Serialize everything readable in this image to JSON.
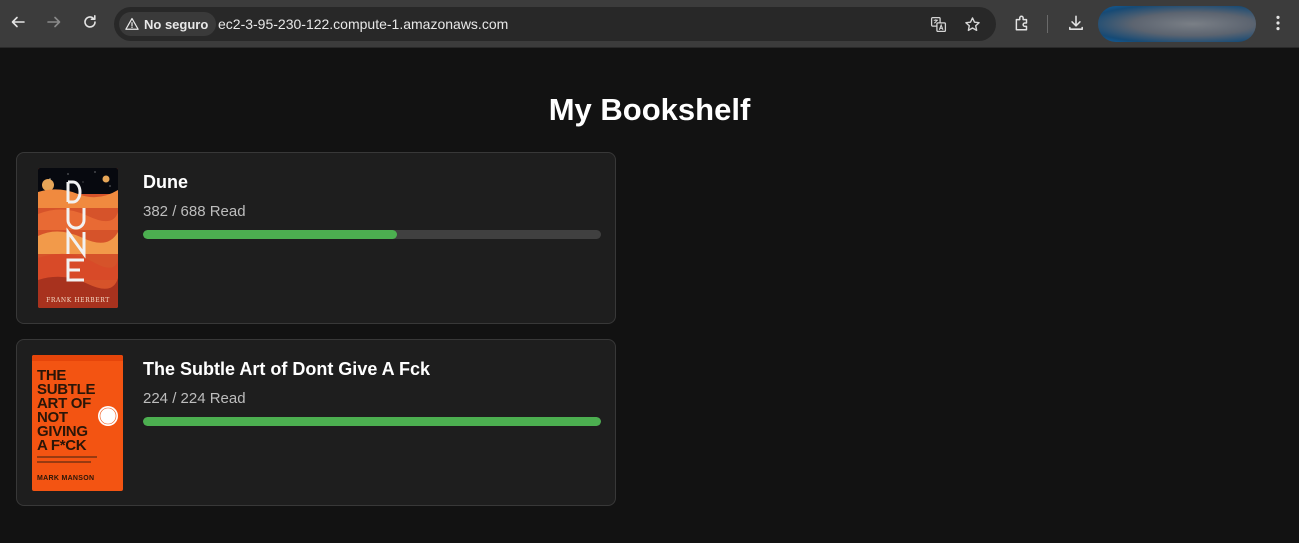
{
  "browser": {
    "security_label": "No seguro",
    "url": "ec2-3-95-230-122.compute-1.amazonaws.com",
    "icons": [
      "back-icon",
      "forward-icon",
      "reload-icon",
      "warning-icon",
      "translate-icon",
      "star-icon",
      "extensions-icon",
      "download-icon",
      "menu-icon"
    ]
  },
  "page": {
    "title": "My Bookshelf"
  },
  "books": [
    {
      "title": "Dune",
      "progress_text": "382 / 688 Read",
      "pages_read": 382,
      "pages_total": 688,
      "cover": {
        "title_text": "DUNE",
        "author_text": "FRANK HERBERT"
      }
    },
    {
      "title": "The Subtle Art of Dont Give A Fck",
      "progress_text": "224 / 224 Read",
      "pages_read": 224,
      "pages_total": 224,
      "cover": {
        "title_text": "THE SUBTLE ART OF NOT GIVING A F*CK",
        "author_text": "MARK MANSON"
      }
    }
  ],
  "colors": {
    "progress_fill": "#4caf50",
    "progress_track": "#404040",
    "card_bg": "#1e1e1e",
    "page_bg": "#121212"
  }
}
